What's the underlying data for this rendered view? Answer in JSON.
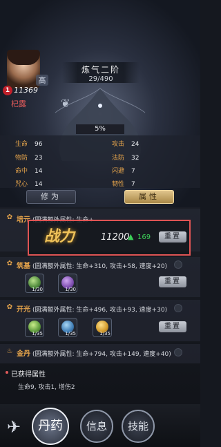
{
  "avatar": {
    "power": "11369",
    "name": "杞露",
    "badge": "1"
  },
  "realm": {
    "name": "炼气二阶",
    "progress": "29/490",
    "moon_label": "高"
  },
  "spirit": {
    "percent": "5%"
  },
  "stats": [
    {
      "label": "生命",
      "value": "96"
    },
    {
      "label": "攻击",
      "value": "24"
    },
    {
      "label": "物防",
      "value": "23"
    },
    {
      "label": "法防",
      "value": "32"
    },
    {
      "label": "命中",
      "value": "14"
    },
    {
      "label": "闪避",
      "value": "7"
    },
    {
      "label": "咒心",
      "value": "14"
    },
    {
      "label": "韧性",
      "value": "7"
    }
  ],
  "tabs": {
    "cultivate": "修为",
    "attribute": "属性"
  },
  "sections": [
    {
      "name": "培元",
      "desc": "(圆满额外属性: 生命+",
      "items": []
    },
    {
      "name": "筑基",
      "desc": "(圆满额外属性: 生命+310, 攻击+58, 速度+20)",
      "items": [
        {
          "count": "1/30"
        },
        {
          "count": "1/30"
        }
      ]
    },
    {
      "name": "开光",
      "desc": "(圆满额外属性: 生命+496, 攻击+93, 速度+30)",
      "items": [
        {
          "count": "1/35"
        },
        {
          "count": "1/35"
        },
        {
          "count": "1/35"
        }
      ]
    },
    {
      "name": "金丹",
      "desc": "(圆满额外属性: 生命+794, 攻击+149, 速度+40)",
      "items": []
    }
  ],
  "reset_label": "重置",
  "combat_power": {
    "emblem": "战力",
    "value": "11200",
    "delta": "169",
    "arrow": "▲"
  },
  "obtained": {
    "title": "已获得属性",
    "text": "生命9, 攻击1, 增伤2"
  },
  "nav": {
    "alchemy": "丹药",
    "letters": "信息",
    "skills": "技能"
  },
  "colors": {
    "accent": "#e7a54b",
    "highlight_border": "#e05454",
    "gain": "#3ccf58"
  }
}
